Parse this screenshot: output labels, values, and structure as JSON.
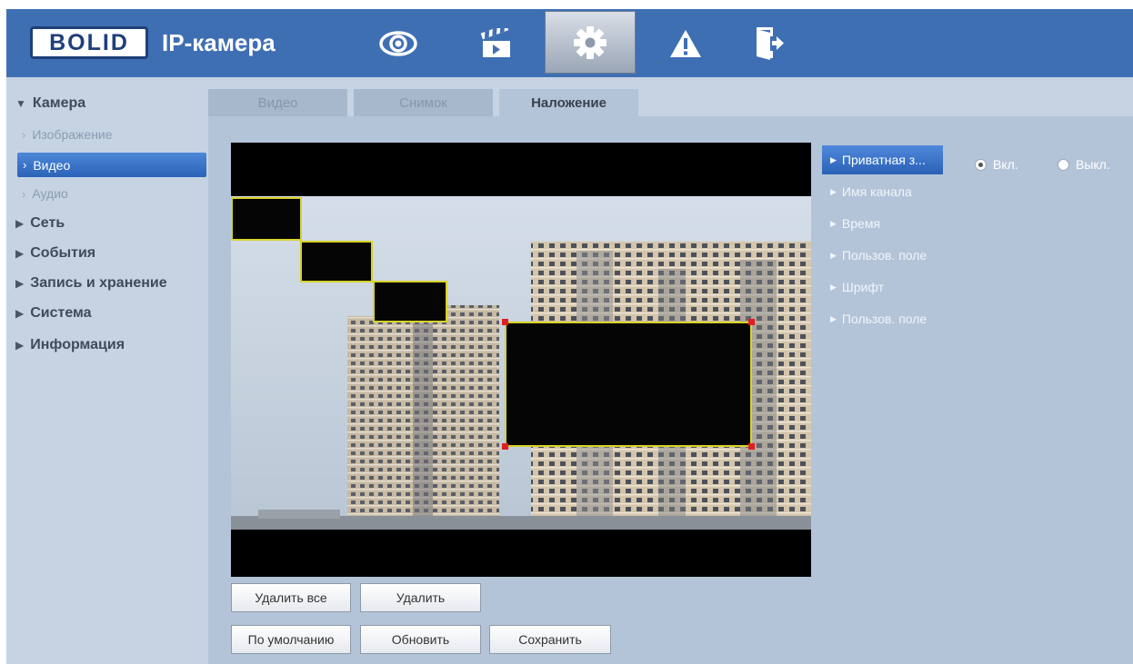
{
  "header": {
    "logo_text": "BOLID",
    "title": "IP-камера",
    "nav": [
      {
        "name": "live-view",
        "icon": "eye-icon"
      },
      {
        "name": "playback",
        "icon": "clapperboard-icon"
      },
      {
        "name": "setup",
        "icon": "gear-icon",
        "active": true
      },
      {
        "name": "alarm",
        "icon": "warning-icon"
      },
      {
        "name": "logout",
        "icon": "exit-icon"
      }
    ]
  },
  "sidebar": {
    "camera": {
      "label": "Камера",
      "expanded": true
    },
    "camera_items": [
      {
        "label": "Изображение"
      },
      {
        "label": "Видео",
        "selected": true
      },
      {
        "label": "Аудио"
      }
    ],
    "sections": [
      {
        "label": "Сеть"
      },
      {
        "label": "События"
      },
      {
        "label": "Запись и хранение"
      },
      {
        "label": "Система"
      },
      {
        "label": "Информация"
      }
    ]
  },
  "tabs": [
    {
      "label": "Видео"
    },
    {
      "label": "Снимок"
    },
    {
      "label": "Наложение",
      "active": true
    }
  ],
  "overlay_menu": [
    {
      "label": "Приватная з...",
      "active": true
    },
    {
      "label": "Имя канала"
    },
    {
      "label": "Время"
    },
    {
      "label": "Пользов. поле"
    },
    {
      "label": "Шрифт"
    },
    {
      "label": "Пользов. поле"
    }
  ],
  "privacy": {
    "on_label": "Вкл.",
    "off_label": "Выкл.",
    "selected": "on"
  },
  "buttons": {
    "delete_all": "Удалить все",
    "delete": "Удалить",
    "default": "По умолчанию",
    "refresh": "Обновить",
    "save": "Сохранить"
  },
  "colors": {
    "header": "#3f6fb3",
    "selected": "#2a63b8",
    "mask_border": "#d8d22a"
  }
}
